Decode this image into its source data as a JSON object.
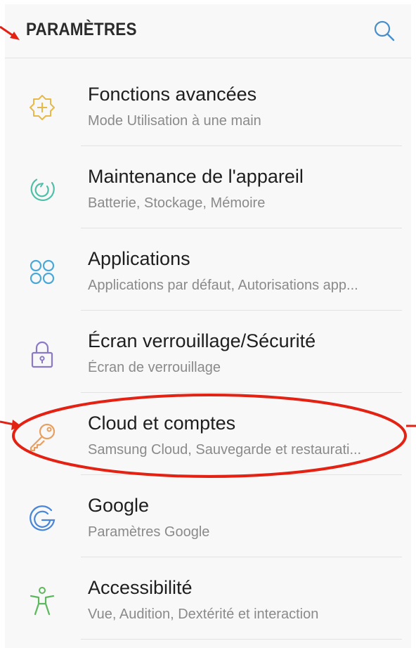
{
  "header": {
    "title": "PARAMÈTRES",
    "search_icon": "search-icon"
  },
  "items": [
    {
      "title": "Fonctions avancées",
      "subtitle": "Mode Utilisation à une main",
      "icon": "advanced-features-icon",
      "color": "#e8b84a"
    },
    {
      "title": "Maintenance de l'appareil",
      "subtitle": "Batterie, Stockage, Mémoire",
      "icon": "device-maintenance-icon",
      "color": "#4fbfa8"
    },
    {
      "title": "Applications",
      "subtitle": "Applications par défaut, Autorisations app...",
      "icon": "apps-icon",
      "color": "#4aa8d8"
    },
    {
      "title": "Écran verrouillage/Sécurité",
      "subtitle": "Écran de verrouillage",
      "icon": "lock-icon",
      "color": "#8b79c8"
    },
    {
      "title": "Cloud et comptes",
      "subtitle": "Samsung Cloud, Sauvegarde et restaurati...",
      "icon": "key-icon",
      "color": "#e8a060"
    },
    {
      "title": "Google",
      "subtitle": "Paramètres Google",
      "icon": "google-icon",
      "color": "#4a86d8"
    },
    {
      "title": "Accessibilité",
      "subtitle": "Vue, Audition, Dextérité et interaction",
      "icon": "accessibility-icon",
      "color": "#5cb85c"
    }
  ],
  "annotation_color": "#e32214"
}
